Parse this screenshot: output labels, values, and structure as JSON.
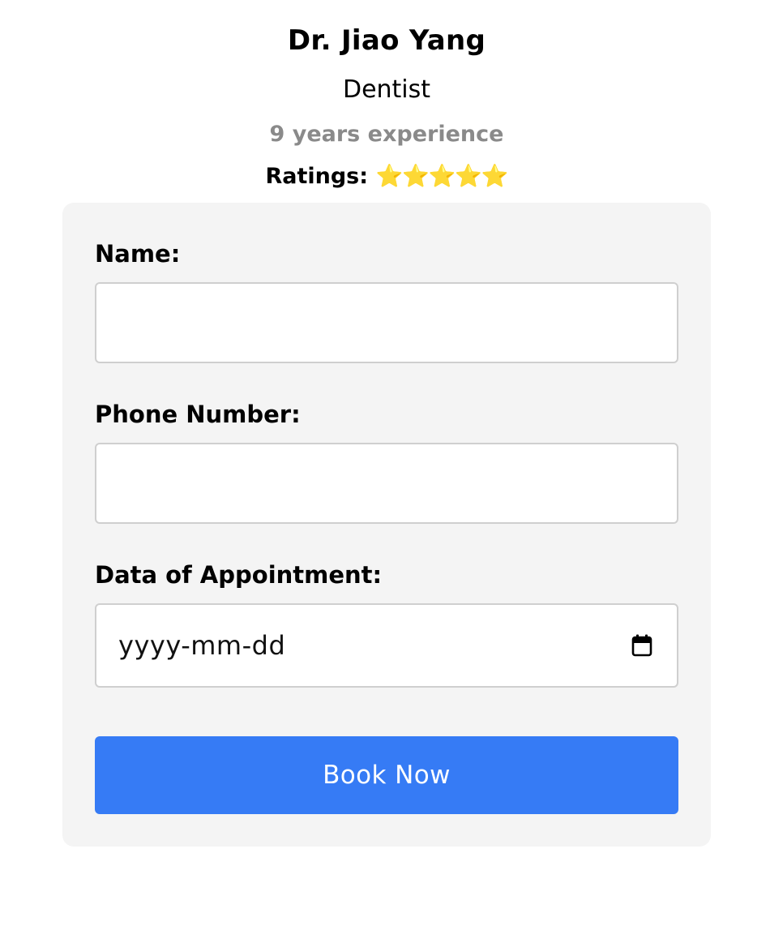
{
  "doctor": {
    "name": "Dr. Jiao Yang",
    "specialty": "Dentist",
    "experience": "9 years experience",
    "ratings_label": "Ratings:",
    "ratings_stars": "⭐⭐⭐⭐⭐",
    "rating_value": 5,
    "rating_max": 5
  },
  "form": {
    "name_label": "Name:",
    "name_value": "",
    "phone_label": "Phone Number:",
    "phone_value": "",
    "date_label": "Data of Appointment:",
    "date_placeholder": "yyyy-mm-dd",
    "book_label": "Book Now"
  },
  "icons": {
    "date_field_icon": "calendar-icon",
    "rating_icon": "star-icon"
  },
  "colors": {
    "card_background": "#f4f4f4",
    "button_background": "#367bf5",
    "button_text": "#ffffff",
    "experience_text": "#8a8a8a",
    "field_border": "#cfcfcf"
  }
}
